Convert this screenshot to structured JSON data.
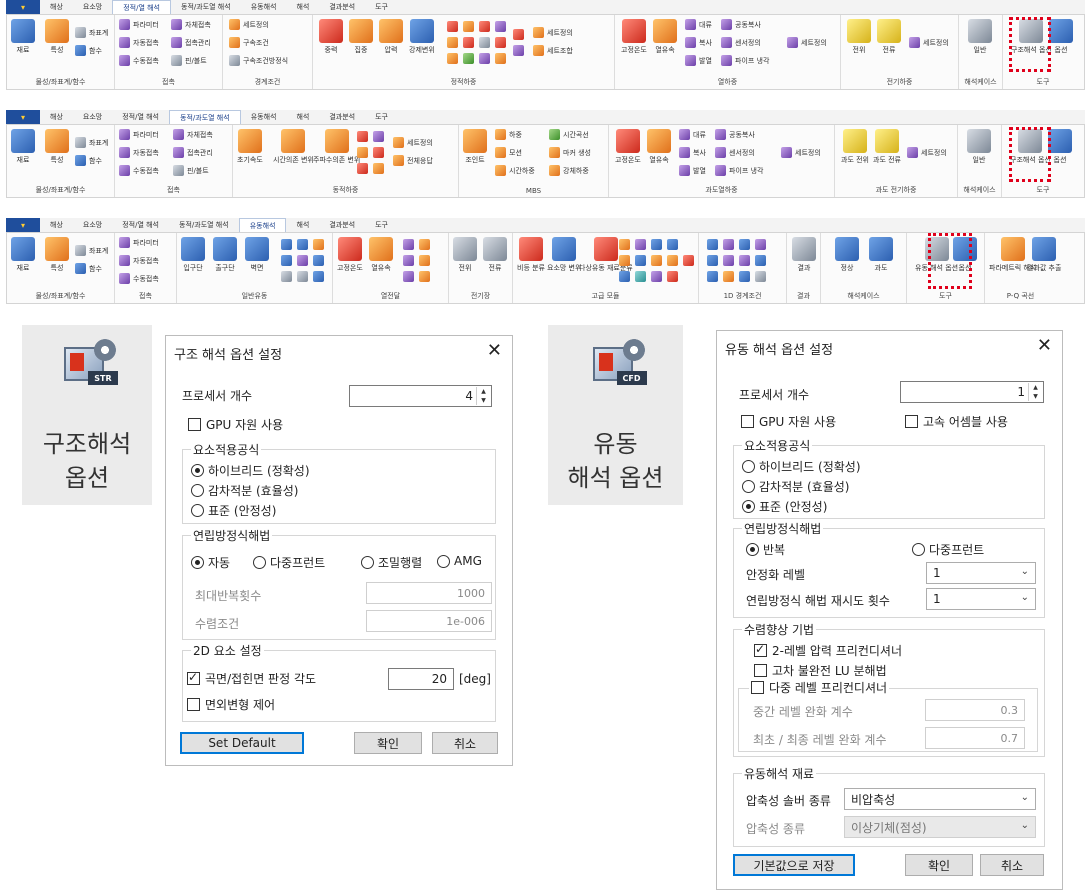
{
  "ribbon1": {
    "tabs": [
      "해상",
      "요소망",
      "정적/열 해석",
      "동적/과도열 해석",
      "유동해석",
      "해석",
      "결과분석",
      "도구"
    ],
    "active_tab": "정적/열 해석",
    "groups": {
      "geometry": {
        "label": "물성/좌표계/함수",
        "material": "재료",
        "property": "특성",
        "coord": "좌표계",
        "func": "함수"
      },
      "contact": {
        "label": "접촉",
        "params": "파라미터",
        "auto": "자동접촉",
        "manual": "수동접촉",
        "self": "자체접촉",
        "manage": "접촉관리",
        "pin": "핀/볼트"
      },
      "boundary": {
        "label": "경계조건",
        "set": "세트정의",
        "constraint": "구속조건",
        "equation": "구속조건방정식"
      },
      "static_load": {
        "label": "정적하중",
        "gravity": "중력",
        "conc": "집중",
        "pressure": "압력",
        "forced": "강제변위",
        "set": "세트정의",
        "combo": "세트조합"
      },
      "heat_load": {
        "label": "열하중",
        "fixed_temp": "고정온도",
        "heat_flux": "열유속",
        "convection": "대류",
        "radiation": "복사",
        "heat_gen": "발열",
        "rad_exchange": "공동복사",
        "sensor": "센서정의",
        "pipe_cool": "파이프 냉각",
        "set": "세트정의"
      },
      "elec_load": {
        "label": "전기하중",
        "potential": "전위",
        "current": "전류",
        "set": "세트정의"
      },
      "case": {
        "label": "해석케이스",
        "general": "일반"
      },
      "tools": {
        "label": "도구",
        "struct_opt": "구조해석 옵션",
        "options": "옵션"
      }
    }
  },
  "ribbon2": {
    "tabs": [
      "해상",
      "요소망",
      "정적/열 해석",
      "동적/과도열 해석",
      "유동해석",
      "해석",
      "결과분석",
      "도구"
    ],
    "active_tab": "동적/과도열 해석",
    "groups": {
      "geometry": {
        "label": "물성/좌표계/함수",
        "material": "재료",
        "property": "특성",
        "coord": "좌표계",
        "func": "함수"
      },
      "contact": {
        "label": "접촉",
        "params": "파라미터",
        "auto": "자동접촉",
        "manual": "수동접촉",
        "self": "자체접촉",
        "manage": "접촉관리",
        "pin": "핀/볼트"
      },
      "dynamic_load": {
        "label": "동적하중",
        "init_vel": "초기속도",
        "time_disp": "시간의존 변위",
        "freq_disp": "주파수의존 변위",
        "set": "세트정의",
        "all_resp": "전체응답"
      },
      "mbs": {
        "label": "MBS",
        "joint": "조인트",
        "load": "하중",
        "motion": "모션",
        "time_load": "시간하중",
        "time_curve": "시간곡선",
        "marker": "마커 생성",
        "rigid": "강체하중"
      },
      "transient_heat": {
        "label": "과도열하중",
        "fixed_temp": "고정온도",
        "heat_flux": "열유속",
        "convection": "대류",
        "radiation": "복사",
        "heat_gen": "발열",
        "rad_exchange": "공동복사",
        "sensor": "센서정의",
        "pipe_cool": "파이프 냉각",
        "set": "세트정의"
      },
      "transient_elec": {
        "label": "과도 전기하중",
        "potential": "과도 전위",
        "current": "과도 전류",
        "set": "세트정의"
      },
      "case": {
        "label": "해석케이스",
        "general": "일반"
      },
      "tools": {
        "label": "도구",
        "struct_opt": "구조해석 옵션",
        "options": "옵션"
      }
    }
  },
  "ribbon3": {
    "tabs": [
      "해상",
      "요소망",
      "정적/열 해석",
      "동적/과도열 해석",
      "유동해석",
      "해석",
      "결과분석",
      "도구"
    ],
    "active_tab": "유동해석",
    "groups": {
      "geometry": {
        "label": "물성/좌표계/함수",
        "material": "재료",
        "property": "특성",
        "coord": "좌표계",
        "func": "함수"
      },
      "contact": {
        "label": "접촉",
        "params": "파라미터",
        "auto": "자동접촉",
        "manual": "수동접촉"
      },
      "general_flow": {
        "label": "일반유동",
        "inlet": "입구단",
        "outlet": "출구단",
        "wall": "벽면"
      },
      "heat": {
        "label": "열전달",
        "fixed_temp": "고정온도",
        "heat_flux": "열유속"
      },
      "elec": {
        "label": "전기장",
        "potential": "전위",
        "current": "전류"
      },
      "advanced": {
        "label": "고급 모듈",
        "boiling": "비등 분류",
        "bubble": "요소망 변위",
        "multiphase": "다상유동 재료분류"
      },
      "bc1d": {
        "label": "1D 경계조건"
      },
      "result": {
        "label": "결과",
        "result": "결과"
      },
      "case": {
        "label": "해석케이스",
        "steady": "정상",
        "transient": "과도"
      },
      "tools": {
        "label": "도구",
        "flow_opt": "유동 해석 옵션",
        "options": "옵션"
      },
      "pq": {
        "label": "P-Q 곡선",
        "param": "파라메트릭 해석",
        "result": "결과값 추출"
      }
    }
  },
  "icon_struct": {
    "badge": "STR",
    "line1": "구조해석",
    "line2": "옵션"
  },
  "icon_flow": {
    "badge": "CFD",
    "line1": "유동",
    "line2": "해석 옵션"
  },
  "dlg_struct": {
    "title": "구조 해석 옵션 설정",
    "close": "✕",
    "processor_label": "프로세서 개수",
    "processor_value": "4",
    "gpu_label": "GPU 자원 사용",
    "group1_title": "요소적용공식",
    "radio_hybrid": "하이브리드 (정확성)",
    "radio_reduced": "감차적분 (효율성)",
    "radio_standard": "표준 (안정성)",
    "group2_title": "연립방정식해법",
    "solver_auto": "자동",
    "solver_multi": "다중프런트",
    "solver_sparse": "조밀행렬",
    "solver_amg": "AMG",
    "max_iter_label": "최대반복횟수",
    "max_iter_value": "1000",
    "conv_label": "수렴조건",
    "conv_value": "1e-006",
    "group3_title": "2D 요소 설정",
    "angle_label": "곡면/접힌면 판정 각도",
    "angle_value": "20",
    "angle_unit": "[deg]",
    "inplane_label": "면외변형 제어",
    "btn_default": "Set Default",
    "btn_ok": "확인",
    "btn_cancel": "취소"
  },
  "dlg_flow": {
    "title": "유동 해석 옵션 설정",
    "close": "✕",
    "processor_label": "프로세서 개수",
    "processor_value": "1",
    "gpu_label": "GPU 자원 사용",
    "fast_label": "고속 어셈블 사용",
    "group1_title": "요소적용공식",
    "radio_hybrid": "하이브리드 (정확성)",
    "radio_reduced": "감차적분 (효율성)",
    "radio_standard": "표준 (안정성)",
    "group2_title": "연립방정식해법",
    "solver_iter": "반복",
    "solver_multi": "다중프런트",
    "stab_label": "안정화 레벨",
    "stab_value": "1",
    "retry_label": "연립방정식 해법 재시도 횟수",
    "retry_value": "1",
    "group3_title": "수렴향상 기법",
    "pc2_label": "2-레벨 압력 프리컨디셔너",
    "ilu_label": "고차 불완전 LU 분해법",
    "multi_pc_label": "다중 레벨 프리컨디셔너",
    "mid_relax_label": "중간 레벨 완화 계수",
    "mid_relax_value": "0.3",
    "end_relax_label": "최초 / 최종 레벨 완화 계수",
    "end_relax_value": "0.7",
    "group4_title": "유동해석 재료",
    "comp_solver_label": "압축성 솔버 종류",
    "comp_solver_value": "비압축성",
    "comp_type_label": "압축성 종류",
    "comp_type_value": "이상기체(점성)",
    "btn_default": "기본값으로 저장",
    "btn_ok": "확인",
    "btn_cancel": "취소"
  }
}
